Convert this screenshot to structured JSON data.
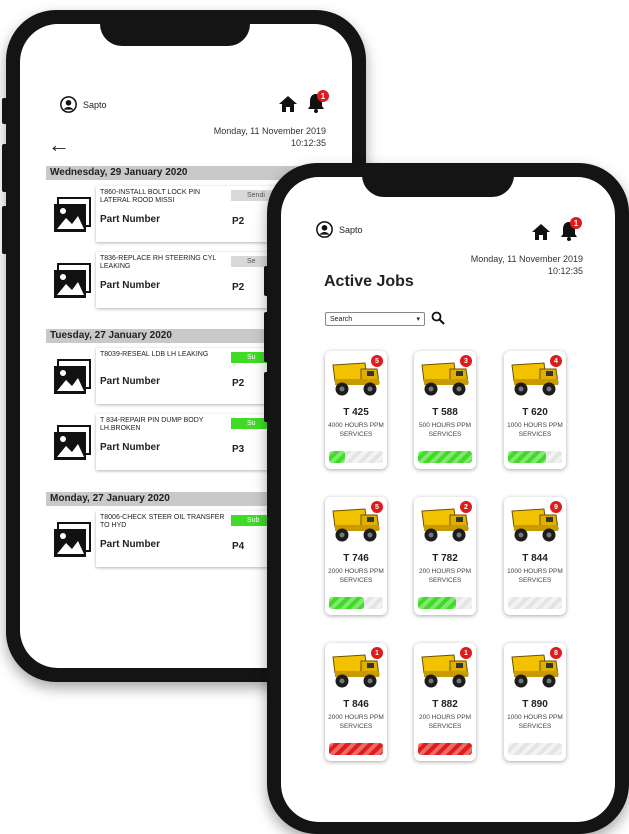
{
  "colors": {
    "success": "#3fdb27",
    "danger": "#e01b1b",
    "sending": "#d9d9d9",
    "date_header": "#c9c9c9",
    "truck": "#f2c200"
  },
  "back_phone": {
    "user_name": "Sapto",
    "notification_count": "1",
    "date_line": "Monday, 11 November 2019",
    "time_line": "10:12:35",
    "groups": [
      {
        "date": "Wednesday, 29 January 2020",
        "jobs": [
          {
            "title": "T860-INSTALL BOLT LOCK PIN LATERAL ROOD MISSI",
            "part_label": "Part Number",
            "part_value": "P2",
            "status": "Sendi",
            "status_type": "sending"
          },
          {
            "title": "T836-REPLACE RH STEERING CYL LEAKING",
            "part_label": "Part Number",
            "part_value": "P2",
            "status": "Se",
            "status_type": "sending"
          }
        ]
      },
      {
        "date": "Tuesday, 27 January 2020",
        "jobs": [
          {
            "title": "T8039-RESEAL LDB LH LEAKING",
            "part_label": "Part Number",
            "part_value": "P2",
            "status": "Su",
            "status_type": "success"
          },
          {
            "title": "T 834-REPAIR PIN DUMP BODY LH.BROKEN",
            "part_label": "Part Number",
            "part_value": "P3",
            "status": "Su",
            "status_type": "success"
          }
        ]
      },
      {
        "date": "Monday, 27 January 2020",
        "jobs": [
          {
            "title": "T8006-CHECK STEER OIL TRANSFER TO HYD",
            "part_label": "Part Number",
            "part_value": "P4",
            "status": "Sub",
            "status_type": "success"
          }
        ]
      }
    ]
  },
  "front_phone": {
    "user_name": "Sapto",
    "notification_count": "1",
    "date_line": "Monday, 11 November 2019",
    "time_line": "10:12:35",
    "title": "Active Jobs",
    "search_placeholder": "Search",
    "units": [
      {
        "name": "T 425",
        "sub": "4000 HOURS PPM SERVICES",
        "badge": "5",
        "progress": 0.3,
        "bar_color": "green"
      },
      {
        "name": "T 588",
        "sub": "500 HOURS PPM SERVICES",
        "badge": "3",
        "progress": 1.0,
        "bar_color": "green"
      },
      {
        "name": "T 620",
        "sub": "1000 HOURS PPM SERVICES",
        "badge": "4",
        "progress": 0.7,
        "bar_color": "green"
      },
      {
        "name": "T 746",
        "sub": "2000 HOURS PPM SERVICES",
        "badge": "5",
        "progress": 0.65,
        "bar_color": "green"
      },
      {
        "name": "T 782",
        "sub": "200 HOURS PPM SERVICES",
        "badge": "2",
        "progress": 0.7,
        "bar_color": "green"
      },
      {
        "name": "T 844",
        "sub": "1000 HOURS PPM SERVICES",
        "badge": "9",
        "progress": 0.0,
        "bar_color": "none"
      },
      {
        "name": "T 846",
        "sub": "2000 HOURS PPM SERVICES",
        "badge": "1",
        "progress": 1.0,
        "bar_color": "red"
      },
      {
        "name": "T 882",
        "sub": "200 HOURS PPM SERVICES",
        "badge": "1",
        "progress": 1.0,
        "bar_color": "red"
      },
      {
        "name": "T 890",
        "sub": "1000 HOURS PPM SERVICES",
        "badge": "8",
        "progress": 0.0,
        "bar_color": "none"
      }
    ]
  }
}
